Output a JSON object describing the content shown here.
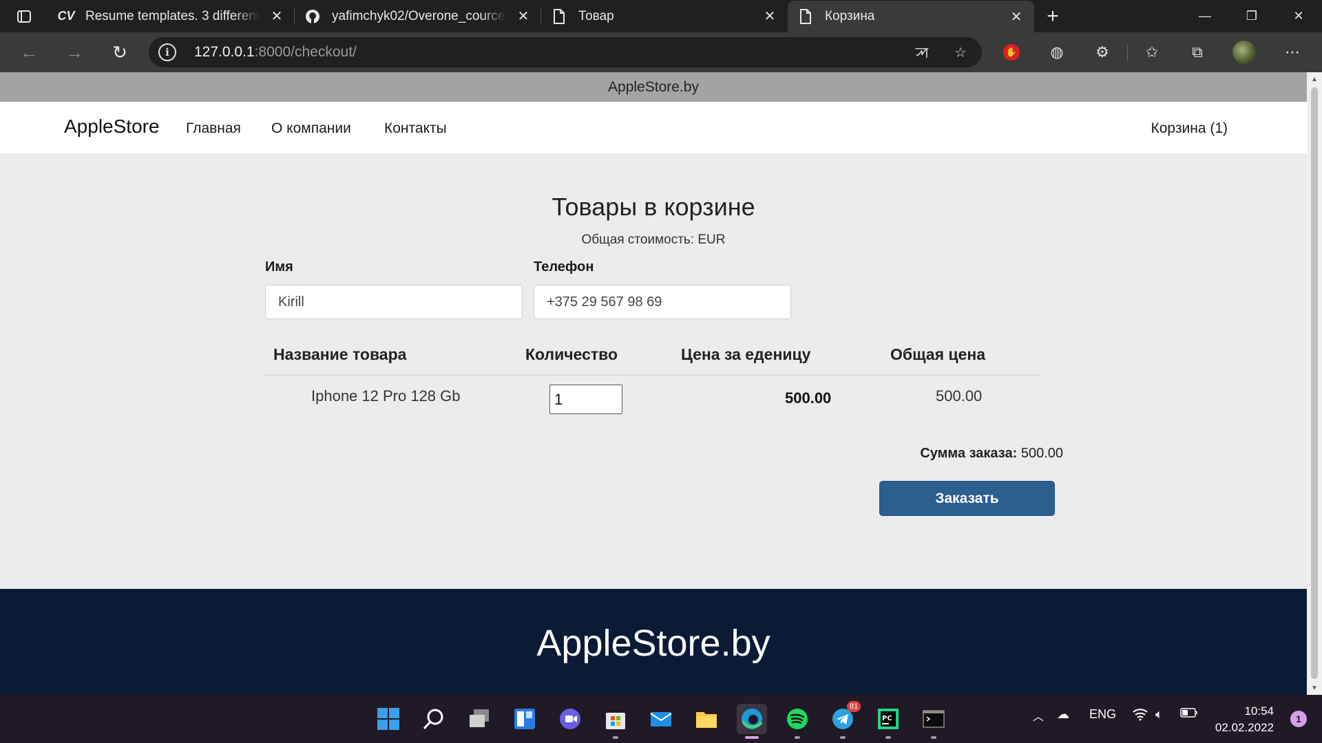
{
  "browser": {
    "tabs": [
      {
        "icon": "cv-icon",
        "icon_text": "CV",
        "title": "Resume templates. 3 different re"
      },
      {
        "icon": "github-icon",
        "title": "yafimchyk02/Overone_cource_pr"
      },
      {
        "icon": "page-icon",
        "title": "Товар"
      },
      {
        "icon": "page-icon",
        "title": "Корзина",
        "active": true
      }
    ],
    "url_host": "127.0.0.1",
    "url_rest": ":8000/checkout/"
  },
  "site": {
    "top_banner": "AppleStore.by",
    "brand": "AppleStore",
    "nav": [
      "Главная",
      "О компании",
      "Контакты"
    ],
    "cart_link": "Корзина (1)"
  },
  "checkout": {
    "title": "Товары в корзине",
    "total_cost": "Общая стоимость: EUR",
    "name_label": "Имя",
    "name_value": "Kirill",
    "phone_label": "Телефон",
    "phone_value": "+375 29 567 98 69",
    "table": {
      "headers": [
        "Название товара",
        "Количество",
        "Цена за еденицу",
        "Общая цена"
      ],
      "rows": [
        {
          "name": "Iphone 12 Pro 128 Gb",
          "quantity": "1",
          "unit_price": "500.00",
          "total": "500.00"
        }
      ]
    },
    "order_sum_label": "Сумма заказа:",
    "order_sum_value": " 500.00",
    "order_button": "Заказать"
  },
  "footer": {
    "title": "AppleStore.by"
  },
  "taskbar": {
    "language": "ENG",
    "time": "10:54",
    "date": "02.02.2022",
    "notifications": "1",
    "telegram_badge": "81"
  },
  "colors": {
    "order_button": "#2b5f8e",
    "footer_bg": "#0b1b36",
    "page_bg": "#ebecee"
  }
}
